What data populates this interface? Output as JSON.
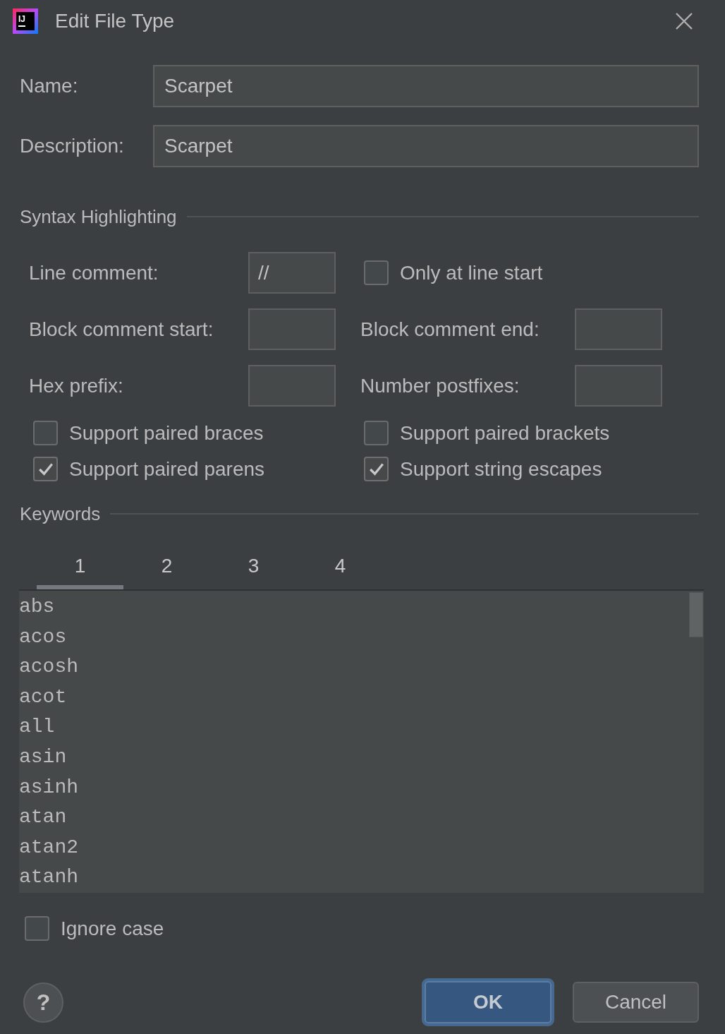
{
  "window": {
    "title": "Edit File Type",
    "icon_text": "IJ"
  },
  "fields": [
    {
      "label": "Name:",
      "value": "Scarpet"
    },
    {
      "label": "Description:",
      "value": "Scarpet"
    }
  ],
  "syntax_highlighting": {
    "title": "Syntax Highlighting",
    "rows": [
      [
        {
          "kind": "field",
          "label": "Line comment:",
          "value": "//"
        },
        {
          "kind": "checkbox",
          "label": "Only at line start",
          "checked": false
        }
      ],
      [
        {
          "kind": "field",
          "label": "Block comment start:"
        },
        {
          "kind": "field",
          "label": "Block comment end:"
        }
      ],
      [
        {
          "kind": "field",
          "label": "Hex prefix:"
        },
        {
          "kind": "field",
          "label": "Number postfixes:"
        }
      ]
    ],
    "options": [
      {
        "label": "Support paired braces",
        "checked": false
      },
      {
        "label": "Support paired brackets",
        "checked": false
      },
      {
        "label": "Support paired parens",
        "checked": true
      },
      {
        "label": "Support string escapes",
        "checked": true
      }
    ]
  },
  "keywords": {
    "title": "Keywords",
    "tabs": [
      {
        "label": "1",
        "selected": true
      },
      {
        "label": "2",
        "selected": false
      },
      {
        "label": "3",
        "selected": false
      },
      {
        "label": "4",
        "selected": false
      }
    ],
    "items": [
      "abs",
      "acos",
      "acosh",
      "acot",
      "all",
      "asin",
      "asinh",
      "atan",
      "atan2",
      "atanh"
    ],
    "ignore_case": {
      "label": "Ignore case",
      "checked": false
    }
  },
  "help_button": {
    "label": "?"
  },
  "buttons": [
    {
      "label": "OK",
      "kind": "default"
    },
    {
      "label": "Cancel",
      "kind": "normal"
    }
  ]
}
